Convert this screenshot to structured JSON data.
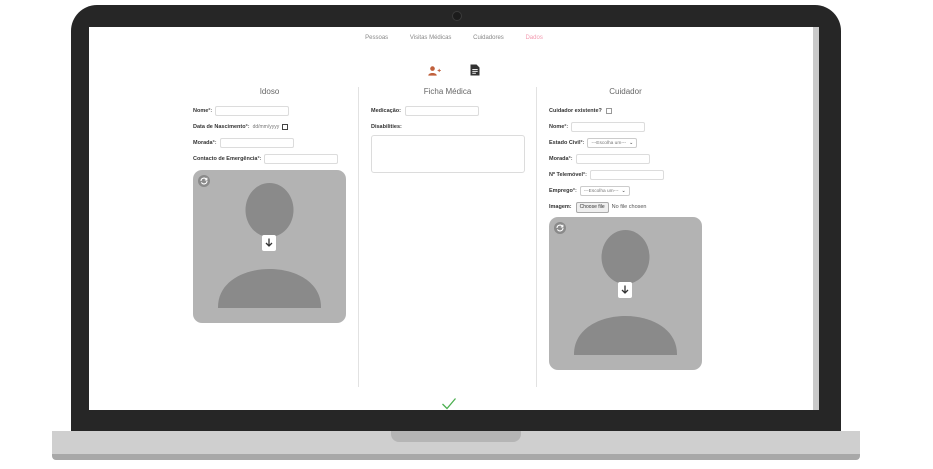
{
  "nav": {
    "items": [
      "Pessoas",
      "Visitas Médicas",
      "Cuidadores",
      "Dados"
    ],
    "active_index": 3
  },
  "tabs": [
    {
      "icon": "add-user-icon",
      "color": "#c0603c"
    },
    {
      "icon": "document-icon",
      "color": "#333333"
    }
  ],
  "idoso": {
    "title": "Idoso",
    "nome_label": "Nome",
    "nascimento_label": "Data de Nascimento",
    "nascimento_placeholder": "dd/mm/yyyy",
    "morada_label": "Morada",
    "contacto_label": "Contacto de Emergência",
    "required_mark": "*:",
    "photo_icon": "person-silhouette-icon"
  },
  "ficha": {
    "title": "Ficha Médica",
    "medicacao_label": "Medicação:",
    "disabilities_label": "Disabilities:"
  },
  "cuidador": {
    "title": "Cuidador",
    "existente_label": "Cuidador existente?",
    "nome_label": "Nome",
    "estado_civil_label": "Estado Civil",
    "estado_civil_value": "---Escolha um---",
    "morada_label": "Morada",
    "telemovel_label": "Nº Telemóvel",
    "emprego_label": "Emprego",
    "emprego_value": "---Escolha um---",
    "imagem_label": "Imagem:",
    "file_button": "Choose file",
    "file_status": "No file chosen",
    "required_mark": "*:",
    "photo_icon": "person-silhouette-icon"
  },
  "colors": {
    "accent": "#f39ab0",
    "confirm": "#4caf50"
  },
  "confirm_icon": "checkmark-icon"
}
